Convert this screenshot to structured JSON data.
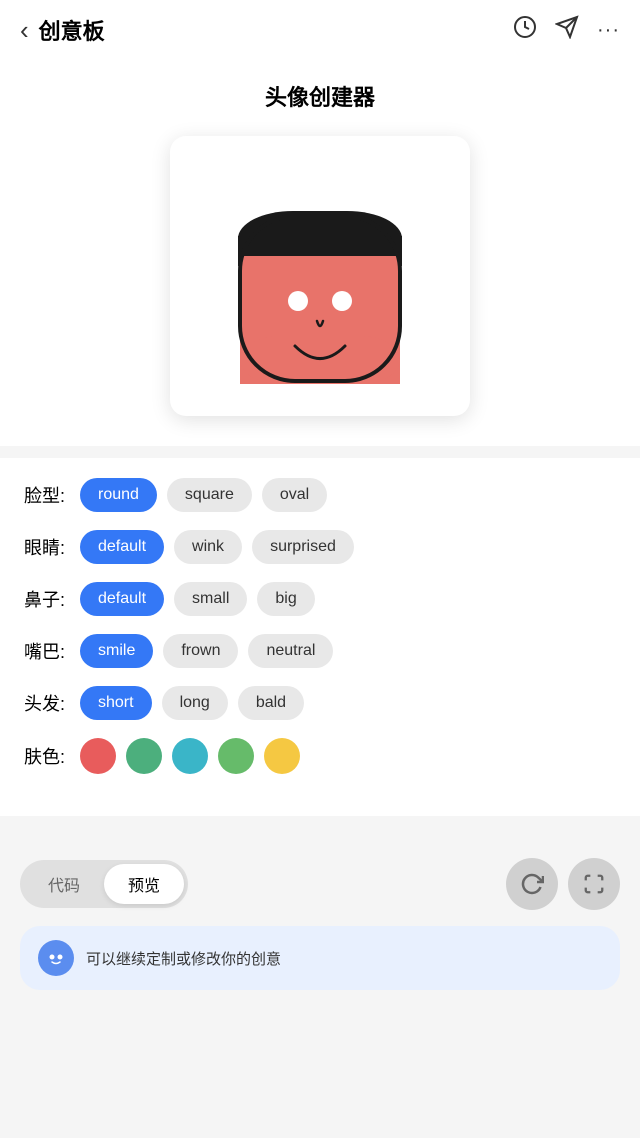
{
  "header": {
    "back_label": "‹",
    "title": "创意板",
    "icon_history": "⏱",
    "icon_send": "◁",
    "icon_more": "•••"
  },
  "avatar_section": {
    "title": "头像创建器"
  },
  "options": [
    {
      "label": "脸型:",
      "label_name": "face-shape-label",
      "buttons": [
        {
          "text": "round",
          "active": true
        },
        {
          "text": "square",
          "active": false
        },
        {
          "text": "oval",
          "active": false
        }
      ]
    },
    {
      "label": "眼睛:",
      "label_name": "eyes-label",
      "buttons": [
        {
          "text": "default",
          "active": true
        },
        {
          "text": "wink",
          "active": false
        },
        {
          "text": "surprised",
          "active": false
        }
      ]
    },
    {
      "label": "鼻子:",
      "label_name": "nose-label",
      "buttons": [
        {
          "text": "default",
          "active": true
        },
        {
          "text": "small",
          "active": false
        },
        {
          "text": "big",
          "active": false
        }
      ]
    },
    {
      "label": "嘴巴:",
      "label_name": "mouth-label",
      "buttons": [
        {
          "text": "smile",
          "active": true
        },
        {
          "text": "frown",
          "active": false
        },
        {
          "text": "neutral",
          "active": false
        }
      ]
    },
    {
      "label": "头发:",
      "label_name": "hair-label",
      "buttons": [
        {
          "text": "short",
          "active": true
        },
        {
          "text": "long",
          "active": false
        },
        {
          "text": "bald",
          "active": false
        }
      ]
    }
  ],
  "skin_colors": {
    "label": "肤色:",
    "colors": [
      "#e85c5c",
      "#4caf7d",
      "#3ab5c8",
      "#66bb6a",
      "#f5c842"
    ]
  },
  "tabs": [
    {
      "text": "代码",
      "active": false
    },
    {
      "text": "预览",
      "active": true
    }
  ],
  "chat": {
    "message": "可以继续定制或修改你的创意"
  }
}
